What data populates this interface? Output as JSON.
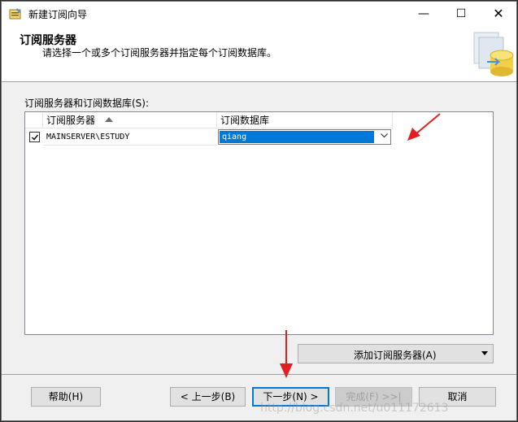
{
  "window": {
    "title": "新建订阅向导",
    "min_glyph": "—",
    "max_glyph": "☐",
    "close_glyph": "✕"
  },
  "header": {
    "title": "订阅服务器",
    "subtitle": "请选择一个或多个订阅服务器并指定每个订阅数据库。"
  },
  "main": {
    "grid_label": "订阅服务器和订阅数据库(S):",
    "columns": [
      "订阅服务器",
      "订阅数据库"
    ],
    "rows": [
      {
        "checked": true,
        "server": "MAINSERVER\\ESTUDY",
        "database": "qiang"
      }
    ],
    "add_button_label": "添加订阅服务器(A)"
  },
  "footer": {
    "help_label": "帮助(H)",
    "back_label": "< 上一步(B)",
    "next_label": "下一步(N) >",
    "finish_label": "完成(F) >>|",
    "cancel_label": "取消"
  },
  "watermark": "http://blog.csdn.net/u011172613",
  "colors": {
    "selection": "#0078d7",
    "annotation_arrow": "#e02020"
  }
}
